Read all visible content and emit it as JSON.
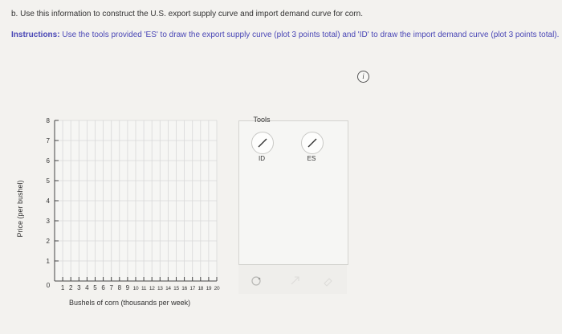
{
  "question": {
    "title": "b. Use this information to construct the U.S. export supply curve and import demand curve for corn.",
    "instructions_label": "Instructions:",
    "instructions_text": " Use the tools provided 'ES' to draw the export supply curve (plot 3 points total) and 'ID' to draw the import demand curve (plot 3 points total)."
  },
  "info_icon": {
    "icon": "info-icon",
    "glyph": "i"
  },
  "tools": {
    "title": "Tools",
    "items": [
      {
        "label": "ID",
        "icon": "line-tool-icon"
      },
      {
        "label": "ES",
        "icon": "line-tool-icon"
      }
    ],
    "lower_icons": [
      "lasso-icon",
      "arrow-icon",
      "eraser-icon"
    ]
  },
  "chart_data": {
    "type": "scatter",
    "xlabel": "Bushels of corn (thousands per week)",
    "ylabel": "Price (per bushel)",
    "xlim": [
      0,
      20
    ],
    "ylim": [
      0,
      8
    ],
    "x_ticks": [
      "1",
      "2",
      "3",
      "4",
      "5",
      "6",
      "7",
      "8",
      "9",
      "10",
      "11",
      "12",
      "13",
      "14",
      "15",
      "16",
      "17",
      "18",
      "19",
      "20"
    ],
    "y_ticks": [
      "1",
      "2",
      "3",
      "4",
      "5",
      "6",
      "7",
      "8"
    ],
    "origin_label": "0",
    "grid": true,
    "series": []
  },
  "colors": {
    "instructions": "#4a47b6",
    "grid": "#d8d8d8",
    "axis": "#444444"
  }
}
